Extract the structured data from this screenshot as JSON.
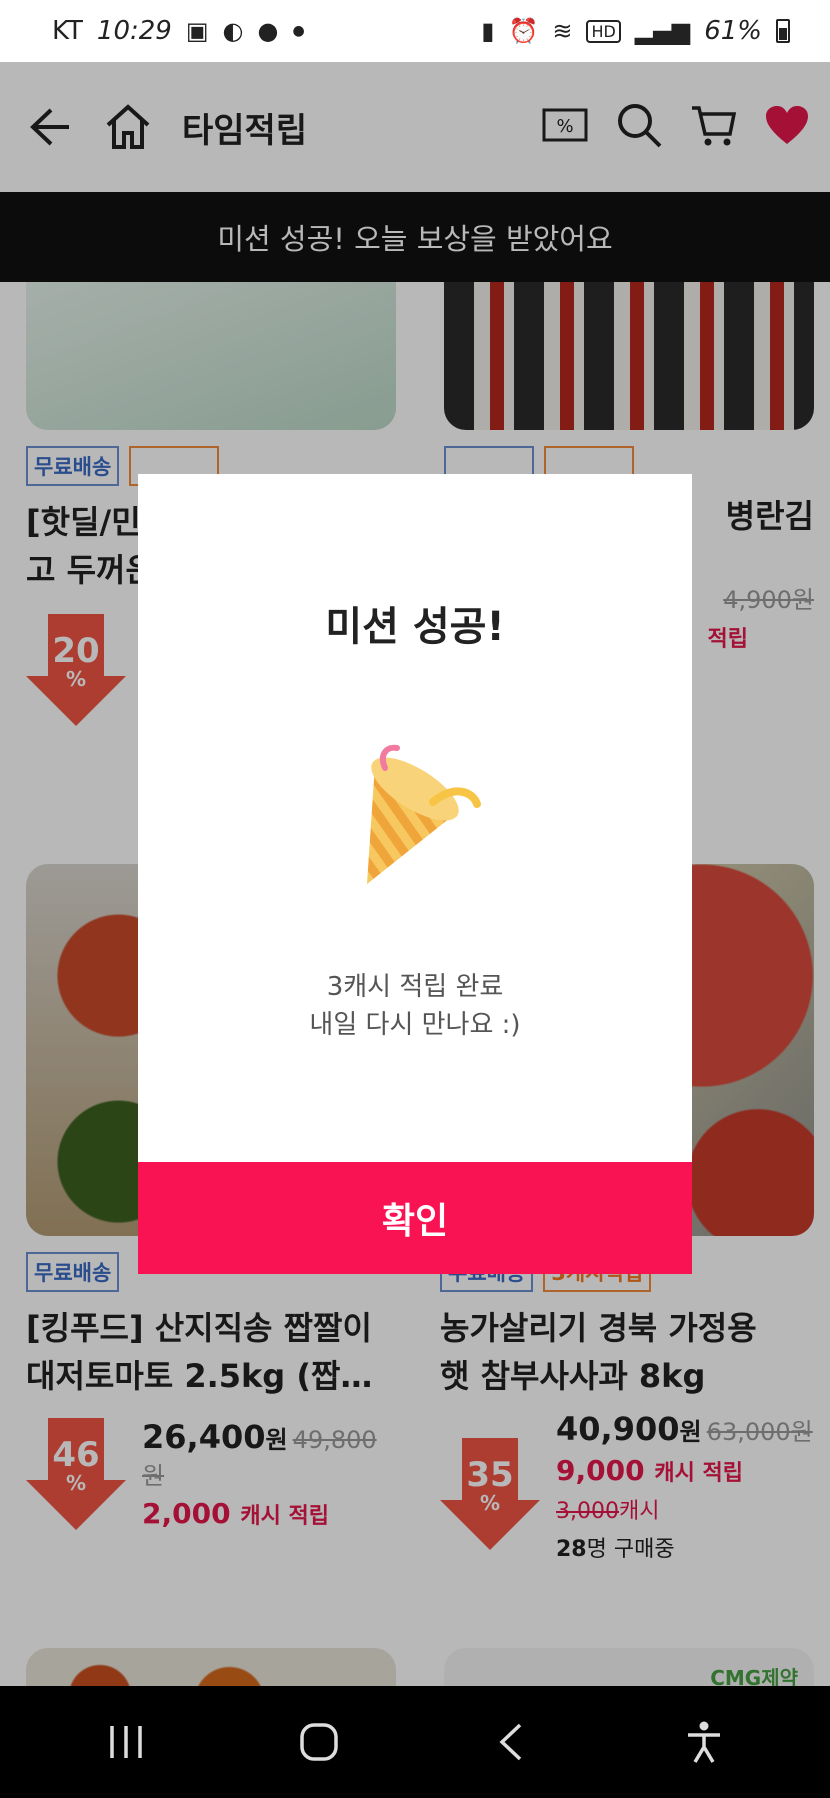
{
  "status_bar": {
    "carrier": "KT",
    "time": "10:29",
    "battery": "61%"
  },
  "header": {
    "title": "타임적립"
  },
  "notice": {
    "text": "미션 성공! 오늘 보상을 받았어요"
  },
  "products": [
    {
      "tags": [
        "무료배송",
        ""
      ],
      "name_line1": "[핫딜/민",
      "name_line2": "고 두꺼운",
      "discount": "20",
      "discount_unit": "%"
    },
    {
      "tags": [
        "",
        ""
      ],
      "name_line1": "병란김",
      "orig_price": "4,900",
      "orig_unit": "원",
      "cash_label": "적립"
    },
    {
      "tags": [
        "무료배송"
      ],
      "name_line1": "[킹푸드] 산지직송 짭짤이",
      "name_line2": "대저토마토 2.5kg (짭…",
      "discount": "46",
      "discount_unit": "%",
      "price": "26,400",
      "price_unit": "원",
      "orig_price": "49,800",
      "orig_unit": "원",
      "cash": "2,000",
      "cash_label": "캐시 적립"
    },
    {
      "tags": [
        "무료배송",
        "3캐시적립"
      ],
      "name_line1": "농가살리기 경북 가정용",
      "name_line2": "햇 참부사사과 8kg",
      "discount": "35",
      "discount_unit": "%",
      "price": "40,900",
      "price_unit": "원",
      "orig_price": "63,000",
      "orig_unit": "원",
      "cash": "9,000",
      "cash_label": "캐시 적립",
      "cash_orig": "3,000",
      "cash_orig_unit": "캐시",
      "buyers": "28",
      "buyers_label": "명 구매중"
    },
    {
      "brand": "CMG제약"
    }
  ],
  "modal": {
    "title": "미션 성공!",
    "message_line1": "3캐시 적립 완료",
    "message_line2": "내일 다시 만나요 :)",
    "confirm_label": "확인"
  },
  "colors": {
    "accent": "#fa1353",
    "notice_bg": "#111111",
    "discount_arrow": "#f05545"
  }
}
